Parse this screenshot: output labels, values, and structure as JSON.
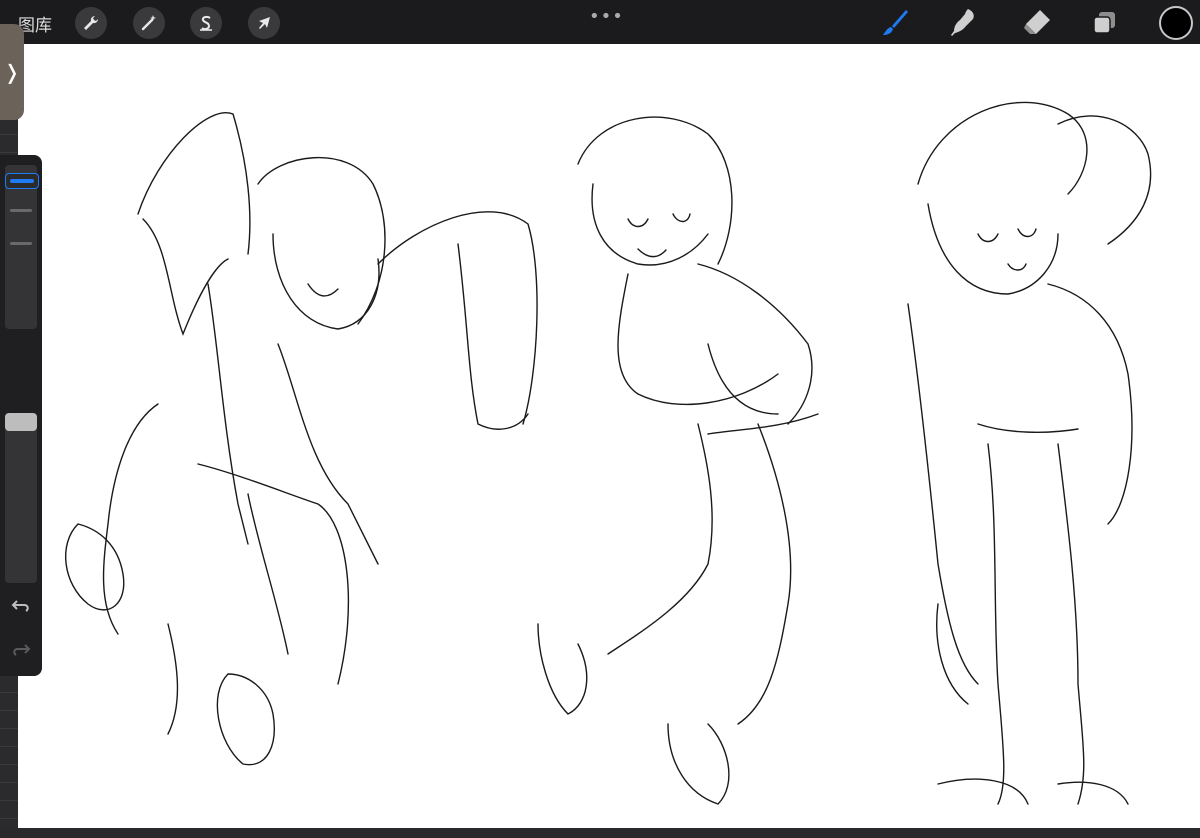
{
  "toolbar": {
    "gallery_label": "图库",
    "actions_icon": "wrench-icon",
    "adjustments_icon": "magic-wand-icon",
    "selection_icon": "selection-s-icon",
    "transform_icon": "arrow-cursor-icon",
    "more_label": "•••",
    "brush_icon": "brush-icon",
    "smudge_icon": "smudge-icon",
    "eraser_icon": "eraser-icon",
    "layers_icon": "layers-icon",
    "current_color": "#000000",
    "active_tool_color": "#1e7bf2"
  },
  "sidebar": {
    "toggle_label": "❭",
    "size_slider_level": 0.05,
    "opacity_slider_level": 0.0,
    "modify_icon": "square-modify-icon",
    "undo_icon": "undo-icon",
    "redo_icon": "redo-icon"
  },
  "canvas": {
    "background": "#ffffff",
    "content": "three-figure-sketch"
  }
}
